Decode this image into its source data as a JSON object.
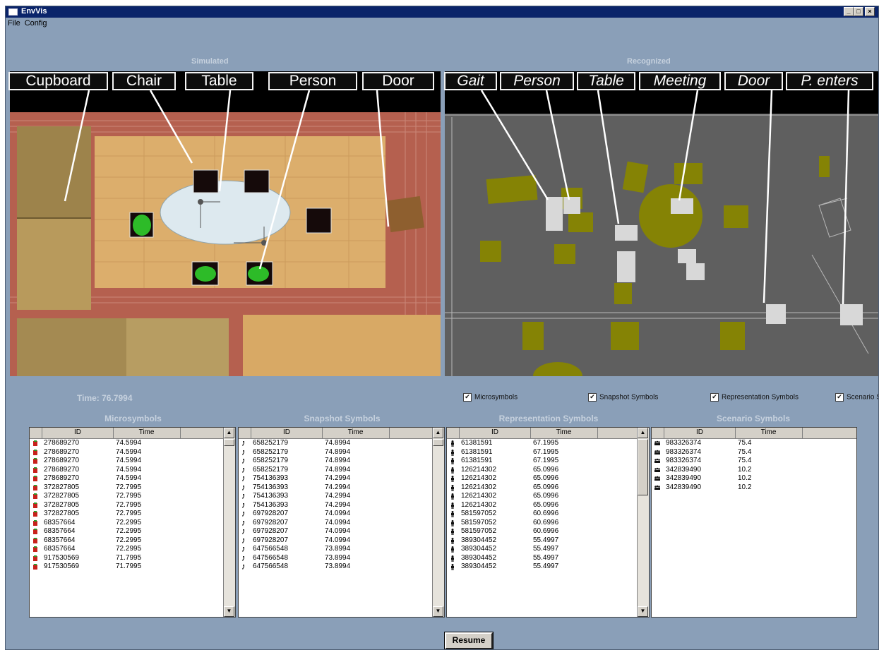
{
  "window": {
    "title": "EnvVis",
    "minimize": "_",
    "maximize": "□",
    "close": "×"
  },
  "menu": [
    "File",
    "Config"
  ],
  "views": {
    "simulated": {
      "title": "Simulated",
      "labels": [
        "Cupboard",
        "Chair",
        "Table",
        "Person",
        "Door"
      ]
    },
    "recognized": {
      "title": "Recognized",
      "labels": [
        "Gait",
        "Person",
        "Table",
        "Meeting",
        "Door",
        "P. enters"
      ]
    }
  },
  "time_label": "Time: 76.7994",
  "checkboxes": [
    {
      "label": "Microsymbols",
      "checked": true
    },
    {
      "label": "Snapshot Symbols",
      "checked": true
    },
    {
      "label": "Representation Symbols",
      "checked": true
    },
    {
      "label": "Scenario S",
      "checked": true
    }
  ],
  "columns": {
    "id": "ID",
    "time": "Time"
  },
  "panels": [
    {
      "title": "Microsymbols",
      "icon": "microsymbol-icon",
      "rows": [
        [
          "278689270",
          "74.5994"
        ],
        [
          "278689270",
          "74.5994"
        ],
        [
          "278689270",
          "74.5994"
        ],
        [
          "278689270",
          "74.5994"
        ],
        [
          "278689270",
          "74.5994"
        ],
        [
          "372827805",
          "72.7995"
        ],
        [
          "372827805",
          "72.7995"
        ],
        [
          "372827805",
          "72.7995"
        ],
        [
          "372827805",
          "72.7995"
        ],
        [
          "68357664",
          "72.2995"
        ],
        [
          "68357664",
          "72.2995"
        ],
        [
          "68357664",
          "72.2995"
        ],
        [
          "68357664",
          "72.2995"
        ],
        [
          "917530569",
          "71.7995"
        ],
        [
          "917530569",
          "71.7995"
        ]
      ]
    },
    {
      "title": "Snapshot Symbols",
      "icon": "footstep-icon",
      "rows": [
        [
          "658252179",
          "74.8994"
        ],
        [
          "658252179",
          "74.8994"
        ],
        [
          "658252179",
          "74.8994"
        ],
        [
          "658252179",
          "74.8994"
        ],
        [
          "754136393",
          "74.2994"
        ],
        [
          "754136393",
          "74.2994"
        ],
        [
          "754136393",
          "74.2994"
        ],
        [
          "754136393",
          "74.2994"
        ],
        [
          "697928207",
          "74.0994"
        ],
        [
          "697928207",
          "74.0994"
        ],
        [
          "697928207",
          "74.0994"
        ],
        [
          "697928207",
          "74.0994"
        ],
        [
          "647566548",
          "73.8994"
        ],
        [
          "647566548",
          "73.8994"
        ],
        [
          "647566548",
          "73.8994"
        ]
      ]
    },
    {
      "title": "Representation Symbols",
      "icon": "person-icon",
      "rows": [
        [
          "61381591",
          "67.1995"
        ],
        [
          "61381591",
          "67.1995"
        ],
        [
          "61381591",
          "67.1995"
        ],
        [
          "126214302",
          "65.0996"
        ],
        [
          "126214302",
          "65.0996"
        ],
        [
          "126214302",
          "65.0996"
        ],
        [
          "126214302",
          "65.0996"
        ],
        [
          "126214302",
          "65.0996"
        ],
        [
          "581597052",
          "60.6996"
        ],
        [
          "581597052",
          "60.6996"
        ],
        [
          "581597052",
          "60.6996"
        ],
        [
          "389304452",
          "55.4997"
        ],
        [
          "389304452",
          "55.4997"
        ],
        [
          "389304452",
          "55.4997"
        ],
        [
          "389304452",
          "55.4997"
        ]
      ]
    },
    {
      "title": "Scenario Symbols",
      "icon": "meeting-icon",
      "rows": [
        [
          "983326374",
          "75.4"
        ],
        [
          "983326374",
          "75.4"
        ],
        [
          "983326374",
          "75.4"
        ],
        [
          "342839490",
          "10.2"
        ],
        [
          "342839490",
          "10.2"
        ],
        [
          "342839490",
          "10.2"
        ]
      ]
    }
  ],
  "resume_button": "Resume"
}
